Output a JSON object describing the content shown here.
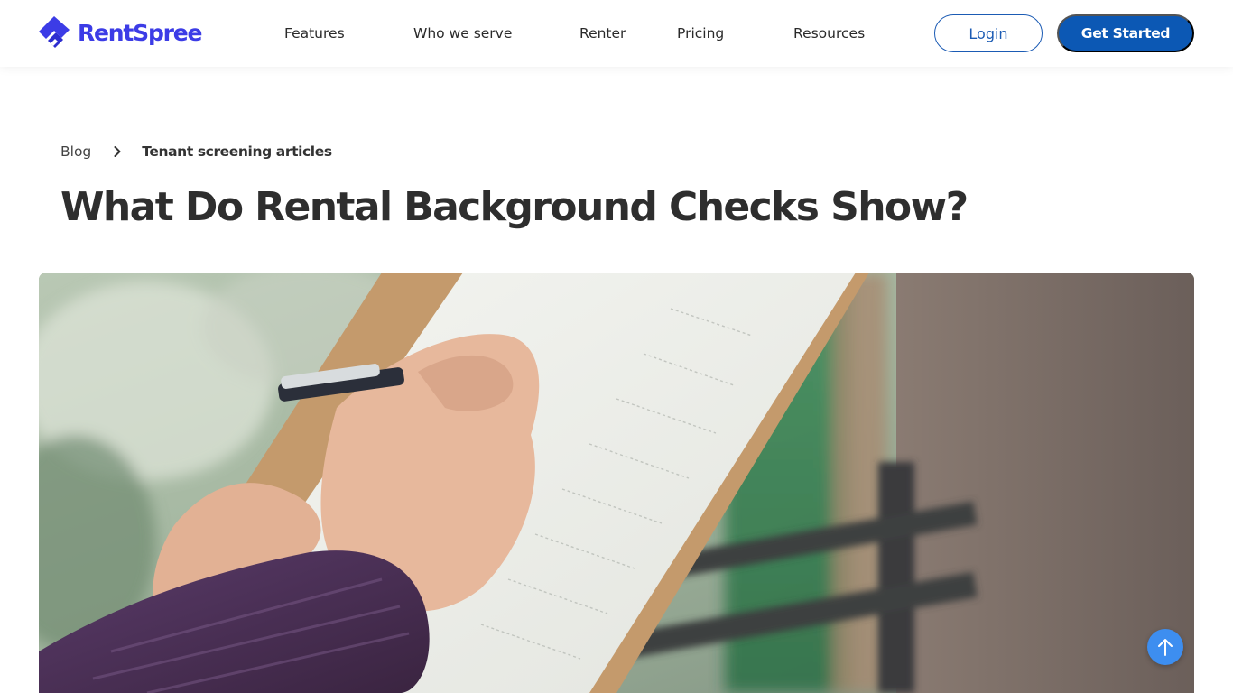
{
  "brand": {
    "name": "RentSpree",
    "color": "#3c3ce6",
    "accent": "#0c58b4"
  },
  "nav": {
    "features": "Features",
    "who_we_serve": "Who we serve",
    "renter": "Renter",
    "pricing": "Pricing",
    "resources": "Resources",
    "login_label": "Login",
    "get_started_label": "Get Started"
  },
  "breadcrumb": {
    "blog": "Blog",
    "separator_icon": "chevron-right-icon",
    "current": "Tenant screening articles"
  },
  "article": {
    "title": "What Do Rental Background Checks Show?"
  },
  "hero_image": {
    "icon": "photo-of-hand-writing-on-clipboard"
  },
  "scroll_top": {
    "icon": "arrow-up-icon",
    "color": "#3d8ef0"
  }
}
